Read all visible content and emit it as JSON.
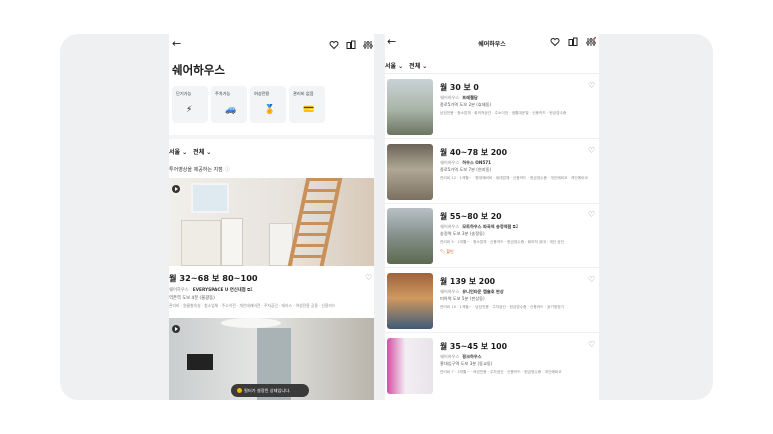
{
  "left_screen": {
    "page_title": "쉐어하우스",
    "icons": [
      "back-arrow-icon",
      "heart-icon",
      "compare-icon",
      "filter-icon"
    ],
    "categories": [
      {
        "label": "단기가능",
        "icon": "⚡"
      },
      {
        "label": "주차가능",
        "icon": "🚙"
      },
      {
        "label": "여성전용",
        "icon": "🏅"
      },
      {
        "label": "관리비 없음",
        "icon": "💳"
      }
    ],
    "filter_region": "서울",
    "filter_all": "전체",
    "section_heading": "투어영상을 제공하는 지점",
    "featured": {
      "price": "월 32~68  보 80~100",
      "brand": "쉐어하우스",
      "name": "EVERYSPACE U 연신내점",
      "compare_count": "1",
      "address": "역촌역 도보 4분 (불광동)",
      "tags": "관리비 · 원룸형숙실 · 청소업체 · 주소이전 · 개인테레비전 · 주차공간 · 테라스 · 여성전용 공용 · 신용카드"
    },
    "toast": "필터가 설정된 상태입니다."
  },
  "right_screen": {
    "title": "쉐어하우스",
    "filter_region": "서울",
    "filter_all": "전체",
    "listings": [
      {
        "price": "월 30  보 0",
        "brand": "쉐어하우스",
        "name": "프레첼담",
        "address": "종로5가역 도보 2분 (효제동)",
        "tags": "남성전용 · 청소업체 · 회의적공간 · 주소이전 · 생활대문열 · 신용카드 · 현금영수증",
        "badge": ""
      },
      {
        "price": "월 40~78  보 200",
        "brand": "쉐어하우스",
        "name": "하우스 ON571",
        "address": "종로5가역 도보 7분 (연지동)",
        "tags": "관리비 12 · 1개월~ · 원대예비비 · 생대업체 · 신용카드 · 현금영수증 · 개인예비코 · 개인예비코",
        "badge": ""
      },
      {
        "price": "월 55~80  보 20",
        "brand": "쉐어하우스",
        "name": "모트하우스 파곡역 송정역점",
        "compare_count": "2",
        "address": "송정역 도보 3분 (송정동)",
        "tags": "관리비 5 · 1개월~ · 청소업체 · 신용카드 · 현금영수증 · 회의적 공대 · 개인 공인",
        "badge": "할인"
      },
      {
        "price": "월 139  보 200",
        "brand": "쉐어하우스",
        "name": "유니언타운 캡슐호 판상",
        "address": "미아역 도보 5분 (판상동)",
        "tags": "관리비 10 · 1개월~ · 남성전용 · 주차공간 · 헌금영수증 · 신용카드 · 공기청정기",
        "badge": ""
      },
      {
        "price": "월 35~45  보 100",
        "brand": "쉐어하우스",
        "name": "핑크하우스",
        "address": "홍대입구역 도보 3분 (동교동)",
        "tags": "관리비 7 · 3개월~ · 여성전용 · 주차공간 · 신용카드 · 현금영수증 · 개인예비코",
        "badge": ""
      }
    ]
  }
}
